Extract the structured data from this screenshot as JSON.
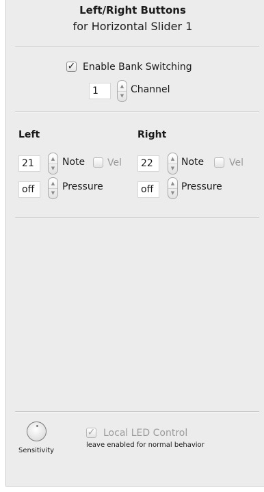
{
  "header": {
    "title": "Left/Right Buttons",
    "subtitle": "for Horizontal Slider 1"
  },
  "bank": {
    "enable_label": "Enable Bank Switching",
    "enabled": "✓",
    "channel_value": "1",
    "channel_label": "Channel"
  },
  "left": {
    "heading": "Left",
    "note_value": "21",
    "note_label": "Note",
    "vel_label": "Vel",
    "pressure_value": "off",
    "pressure_label": "Pressure"
  },
  "right": {
    "heading": "Right",
    "note_value": "22",
    "note_label": "Note",
    "vel_label": "Vel",
    "pressure_value": "off",
    "pressure_label": "Pressure"
  },
  "footer": {
    "sensitivity_label": "Sensitivity",
    "local_led_label": "Local LED Control",
    "local_led_checked": "✓",
    "local_led_hint": "leave enabled for normal behavior"
  },
  "icons": {
    "stepper_up": "▲",
    "stepper_down": "▼",
    "knob": "knob-icon"
  }
}
